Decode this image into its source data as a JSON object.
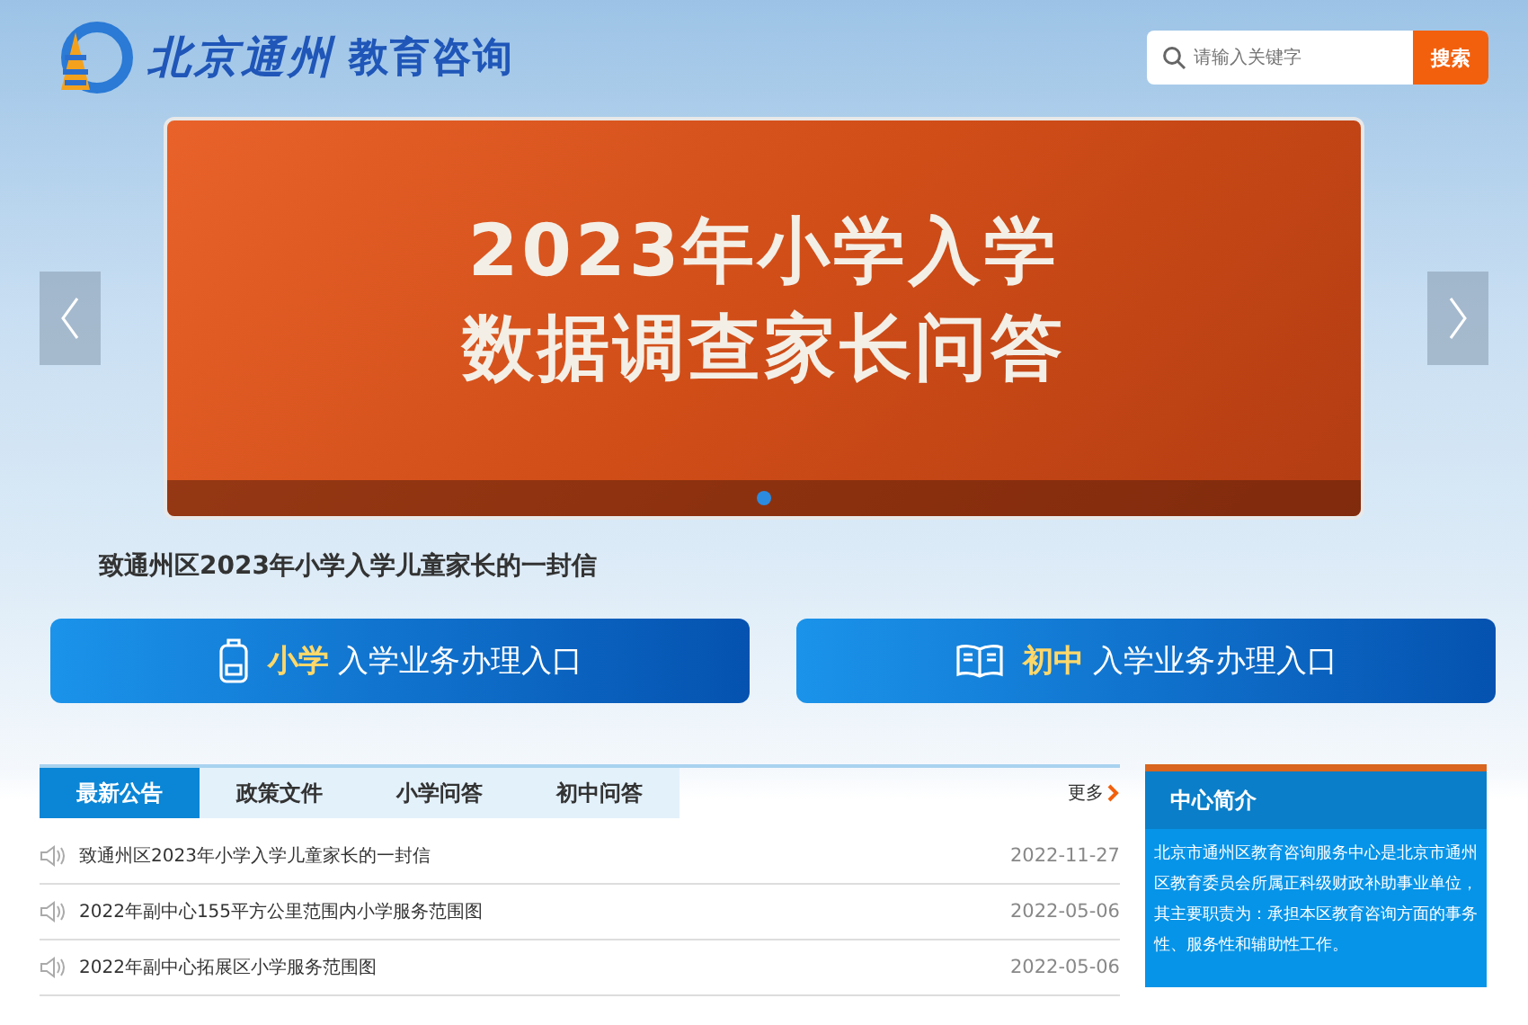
{
  "header": {
    "logo_text": "北京通州",
    "logo_subtext": "教育咨询",
    "search": {
      "placeholder": "请输入关键字",
      "button": "搜索"
    }
  },
  "banner": {
    "title_lines": [
      "2023年小学入学",
      "数据调查家长问答"
    ],
    "dots": [
      {
        "selected": true
      }
    ],
    "caption": "致通州区2023年小学入学儿童家长的一封信"
  },
  "entries": [
    {
      "kind": "backpack",
      "highlight": "小学",
      "label": "入学业务办理入口"
    },
    {
      "kind": "book",
      "highlight": "初中",
      "label": "入学业务办理入口"
    }
  ],
  "news": {
    "tabs": [
      {
        "label": "最新公告",
        "selected": true
      },
      {
        "label": "政策文件",
        "selected": false
      },
      {
        "label": "小学问答",
        "selected": false
      },
      {
        "label": "初中问答",
        "selected": false
      }
    ],
    "more": "更多",
    "items": [
      {
        "title": "致通州区2023年小学入学儿童家长的一封信",
        "date": "2022-11-27"
      },
      {
        "title": "2022年副中心155平方公里范围内小学服务范围图",
        "date": "2022-05-06"
      },
      {
        "title": "2022年副中心拓展区小学服务范围图",
        "date": "2022-05-06"
      }
    ]
  },
  "intro": {
    "title": "中心简介",
    "text": "北京市通州区教育咨询服务中心是北京市通州区教育委员会所属正科级财政补助事业单位，其主要职责为：承担本区教育咨询方面的事务性、服务性和辅助性工作。"
  }
}
